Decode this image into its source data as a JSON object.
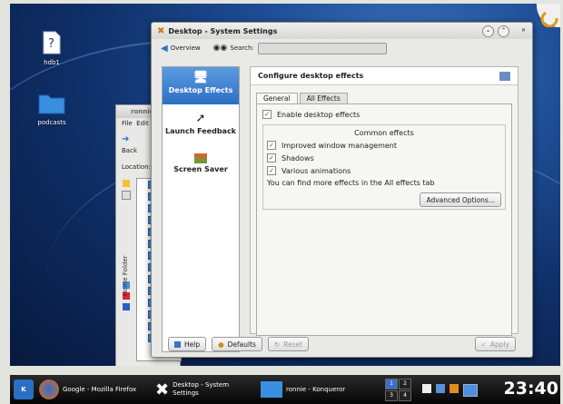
{
  "desktop": {
    "icons": [
      {
        "label": "hdb1",
        "icon": "drive-icon"
      },
      {
        "label": "podcasts",
        "icon": "folder-icon"
      }
    ]
  },
  "konqueror": {
    "title": "ronnie",
    "menu": [
      "File",
      "Edit"
    ],
    "back": "Back",
    "location": "Location:",
    "sidebar_label": "Home Folder"
  },
  "window": {
    "title": "Desktop - System Settings",
    "overview": "Overview",
    "search_label": "Search:",
    "search_value": "",
    "categories": [
      {
        "label": "Desktop Effects",
        "selected": true
      },
      {
        "label": "Launch Feedback",
        "selected": false
      },
      {
        "label": "Screen Saver",
        "selected": false
      }
    ],
    "header": "Configure desktop effects",
    "tabs": [
      "General",
      "All Effects"
    ],
    "enable": "Enable desktop effects",
    "group_title": "Common effects",
    "options": [
      "Improved window management",
      "Shadows",
      "Various animations"
    ],
    "hint": "You can find more effects in the All effects tab",
    "advanced": "Advanced Options...",
    "help": "Help",
    "defaults": "Defaults",
    "reset": "Reset",
    "apply": "Apply"
  },
  "taskbar": {
    "tasks": [
      {
        "label": "Google - Mozilla Firefox"
      },
      {
        "label_1": "Desktop - System",
        "label_2": "Settings"
      },
      {
        "label": "ronnie - Konqueror"
      }
    ],
    "pager": [
      "1",
      "2",
      "3",
      "4"
    ],
    "clock": "23:40"
  },
  "colors": {
    "accent": "#2c6fc4",
    "desktop": "#1e4e96"
  }
}
